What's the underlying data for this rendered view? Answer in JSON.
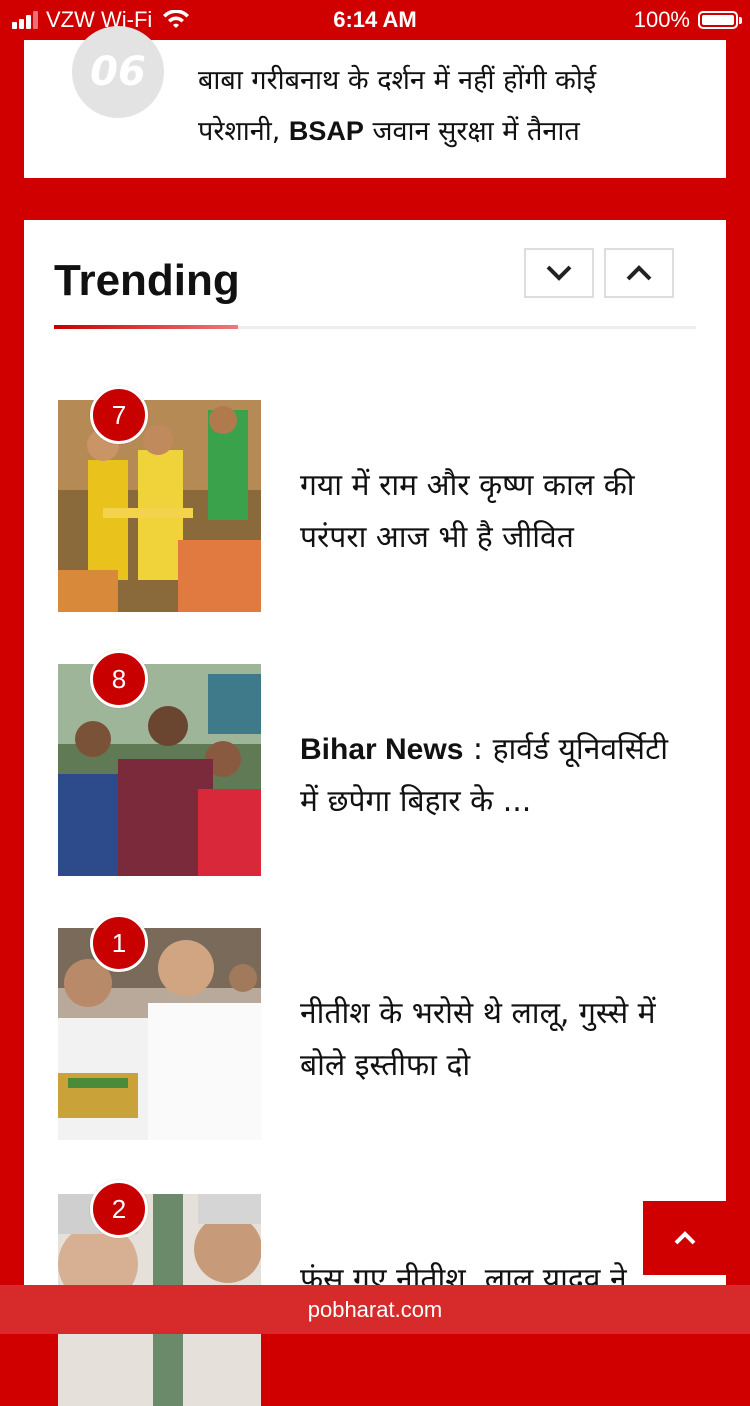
{
  "status_bar": {
    "carrier": "VZW Wi-Fi",
    "time": "6:14 AM",
    "battery": "100%"
  },
  "top_item": {
    "rank": "06",
    "title_part1": "बाबा गरीबनाथ के दर्शन में नहीं होंगी कोई परेशानी, ",
    "title_bold": "BSAP",
    "title_part2": " जवान सुरक्षा में तैनात"
  },
  "trending": {
    "heading": "Trending",
    "items": [
      {
        "rank": "7",
        "title": "गया में राम और कृष्ण काल की परंपरा आज भी है जीवित",
        "image": "children-ritual-photo"
      },
      {
        "rank": "8",
        "title_bold": "Bihar News",
        "title": " : हार्वर्ड यूनिवर्सिटी में छपेगा बिहार के ...",
        "image": "three-boys-photo"
      },
      {
        "rank": "1",
        "title": "नीतीश के भरोसे थे लालू, गुस्से में बोले इस्तीफा दो",
        "image": "politicians-photo"
      },
      {
        "rank": "2",
        "title": "फंस गए नीतीश, लालू यादव ने",
        "image": "two-politicians-photo"
      }
    ]
  },
  "footer": {
    "url": "pobharat.com"
  },
  "colors": {
    "brand_red": "#d10000",
    "badge_red": "#c80000"
  }
}
